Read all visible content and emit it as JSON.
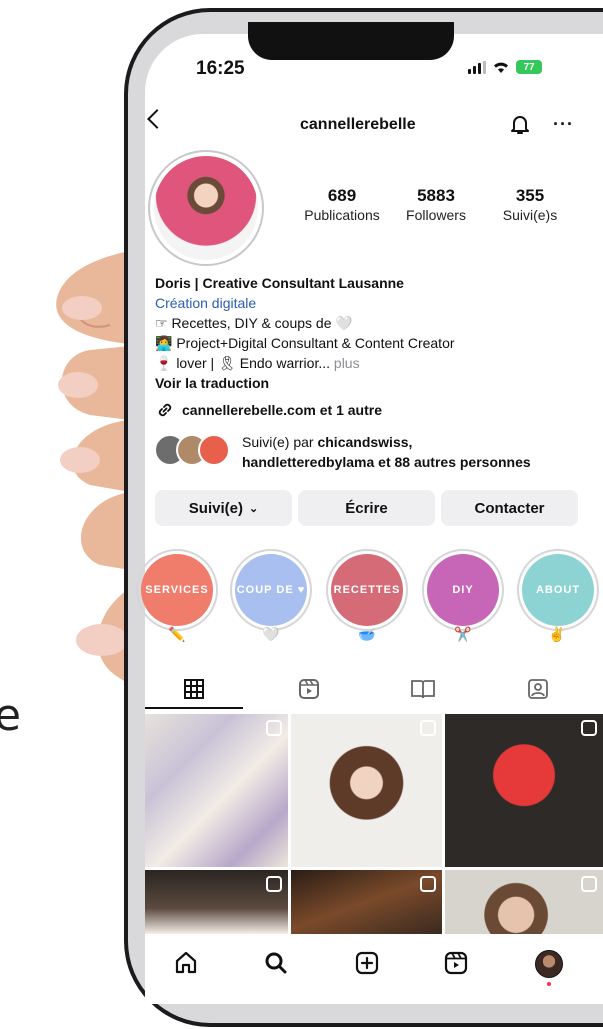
{
  "status_bar": {
    "time": "16:25",
    "battery": "77"
  },
  "header": {
    "username": "cannellerebelle"
  },
  "stats": [
    {
      "value": "689",
      "label": "Publications"
    },
    {
      "value": "5883",
      "label": "Followers"
    },
    {
      "value": "355",
      "label": "Suivi(e)s"
    }
  ],
  "bio": {
    "name": "Doris | Creative Consultant Lausanne",
    "category": "Création digitale",
    "line1": "☞ Recettes, DIY & coups de 🤍",
    "line2": "👩‍💻 Project+Digital Consultant & Content Creator",
    "line3": "🍷 lover | 🎗 Endo warrior...",
    "more": "plus",
    "translate": "Voir la traduction"
  },
  "link": {
    "text": "cannellerebelle.com et 1 autre"
  },
  "followed_by": {
    "prefix": "Suivi(e) par ",
    "names": "chicandswiss,",
    "names2": "handletteredbylama",
    "suffix": "et 88 autres personnes"
  },
  "buttons": {
    "following": "Suivi(e)",
    "message": "Écrire",
    "contact": "Contacter"
  },
  "highlights": [
    {
      "label": "SERVICES",
      "emoji": "✏️",
      "color": "#f07c6c"
    },
    {
      "label": "COUP DE ♥",
      "emoji": "🤍",
      "color": "#a9bff0"
    },
    {
      "label": "RECETTES",
      "emoji": "🥣",
      "color": "#d66b78"
    },
    {
      "label": "DIY",
      "emoji": "✂️",
      "color": "#c766b7"
    },
    {
      "label": "ABOUT",
      "emoji": "✌",
      "color": "#8ed3d3"
    }
  ],
  "colors": {
    "link_blue": "#2b5fb0",
    "button_bg": "#efeff1",
    "notification_dot": "#ff2d55"
  },
  "icons": {
    "tabs": [
      "grid-icon",
      "reels-icon",
      "guides-icon",
      "tagged-icon"
    ],
    "nav": [
      "home-icon",
      "search-icon",
      "create-icon",
      "reels-icon",
      "profile-avatar"
    ]
  }
}
